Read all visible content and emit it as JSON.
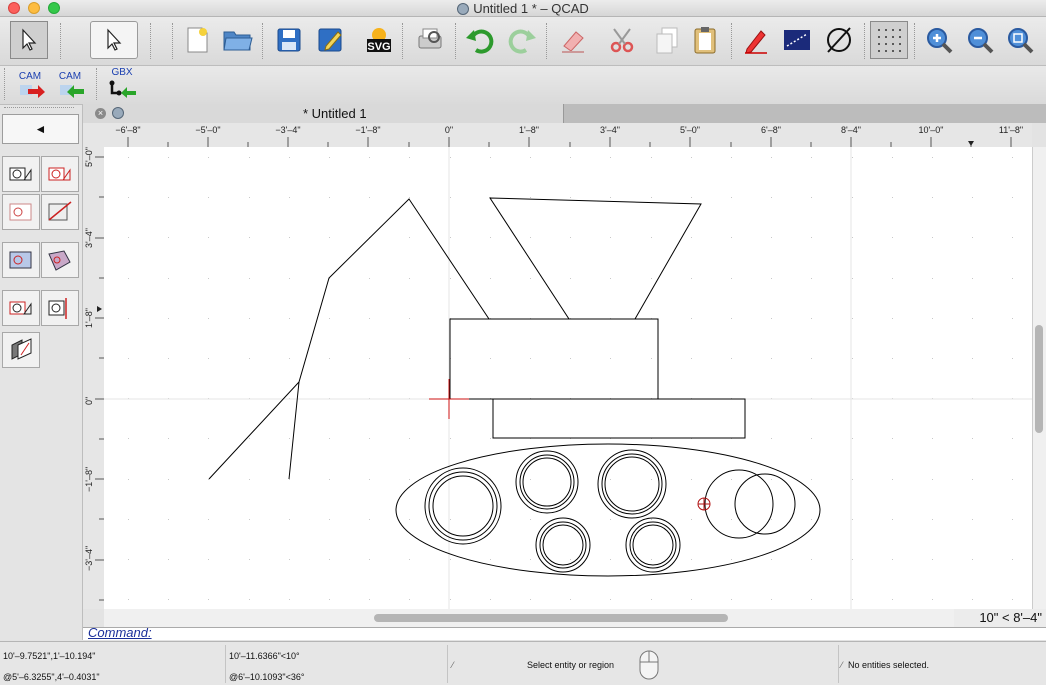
{
  "window": {
    "title": "Untitled 1 * – QCAD"
  },
  "toolbar": {
    "items": [
      {
        "name": "select-pointer",
        "icon": "arrow-pointer-icon"
      },
      {
        "name": "select-tool",
        "icon": "arrow-pointer-icon"
      },
      {
        "name": "new",
        "icon": "new-document-icon"
      },
      {
        "name": "open",
        "icon": "folder-icon"
      },
      {
        "name": "save",
        "icon": "floppy-disk-icon"
      },
      {
        "name": "save-as",
        "icon": "edit-document-icon"
      },
      {
        "name": "export-svg",
        "icon": "svg-export-icon",
        "label": "SVG"
      },
      {
        "name": "print-preview",
        "icon": "print-preview-icon"
      },
      {
        "name": "undo",
        "icon": "undo-icon"
      },
      {
        "name": "redo",
        "icon": "redo-icon"
      },
      {
        "name": "erase",
        "icon": "eraser-icon"
      },
      {
        "name": "cut",
        "icon": "scissors-icon"
      },
      {
        "name": "copy",
        "icon": "copy-icon"
      },
      {
        "name": "paste",
        "icon": "clipboard-icon"
      },
      {
        "name": "pen",
        "icon": "pencil-icon"
      },
      {
        "name": "dimension",
        "icon": "dimension-icon"
      },
      {
        "name": "circle-line",
        "icon": "circle-line-icon"
      },
      {
        "name": "grid",
        "icon": "grid-icon"
      },
      {
        "name": "zoom-in",
        "icon": "zoom-in-icon"
      },
      {
        "name": "zoom-out",
        "icon": "zoom-out-icon"
      },
      {
        "name": "zoom-auto",
        "icon": "zoom-auto-icon"
      }
    ]
  },
  "cam_toolbar": {
    "cam_export_label": "CAM",
    "cam_import_label": "CAM",
    "gbx_label": "GBX"
  },
  "dock": {
    "back_label": "◄"
  },
  "tab": {
    "title": "* Untitled 1"
  },
  "ruler": {
    "horizontal": [
      "−6'–8\"",
      "−5'–0\"",
      "−3'–4\"",
      "−1'–8\"",
      "0\"",
      "1'–8\"",
      "3'–4\"",
      "5'–0\"",
      "6'–8\"",
      "8'–4\"",
      "10'–0\"",
      "11'–8\""
    ],
    "vertical": [
      "5'–0\"",
      "3'–4\"",
      "1'–8\"",
      "0\"",
      "−1'–8\"",
      "−3'–4\""
    ]
  },
  "scale_label": "10\" < 8'–4\"",
  "command": {
    "label": "Command:"
  },
  "status": {
    "abs_coord": "10'–9.7521\",1'–10.194\"",
    "rel_coord": "@5'–6.3255\",4'–0.4031\"",
    "abs_polar": "10'–11.6366\"<10°",
    "rel_polar": "@6'–10.1093\"<36°",
    "prompt": "Select entity or region",
    "selection": "No entities selected."
  },
  "colors": {
    "crosshair": "#cc1111",
    "snap_marker": "#b01010",
    "grid_dot": "#c8c8c8"
  }
}
